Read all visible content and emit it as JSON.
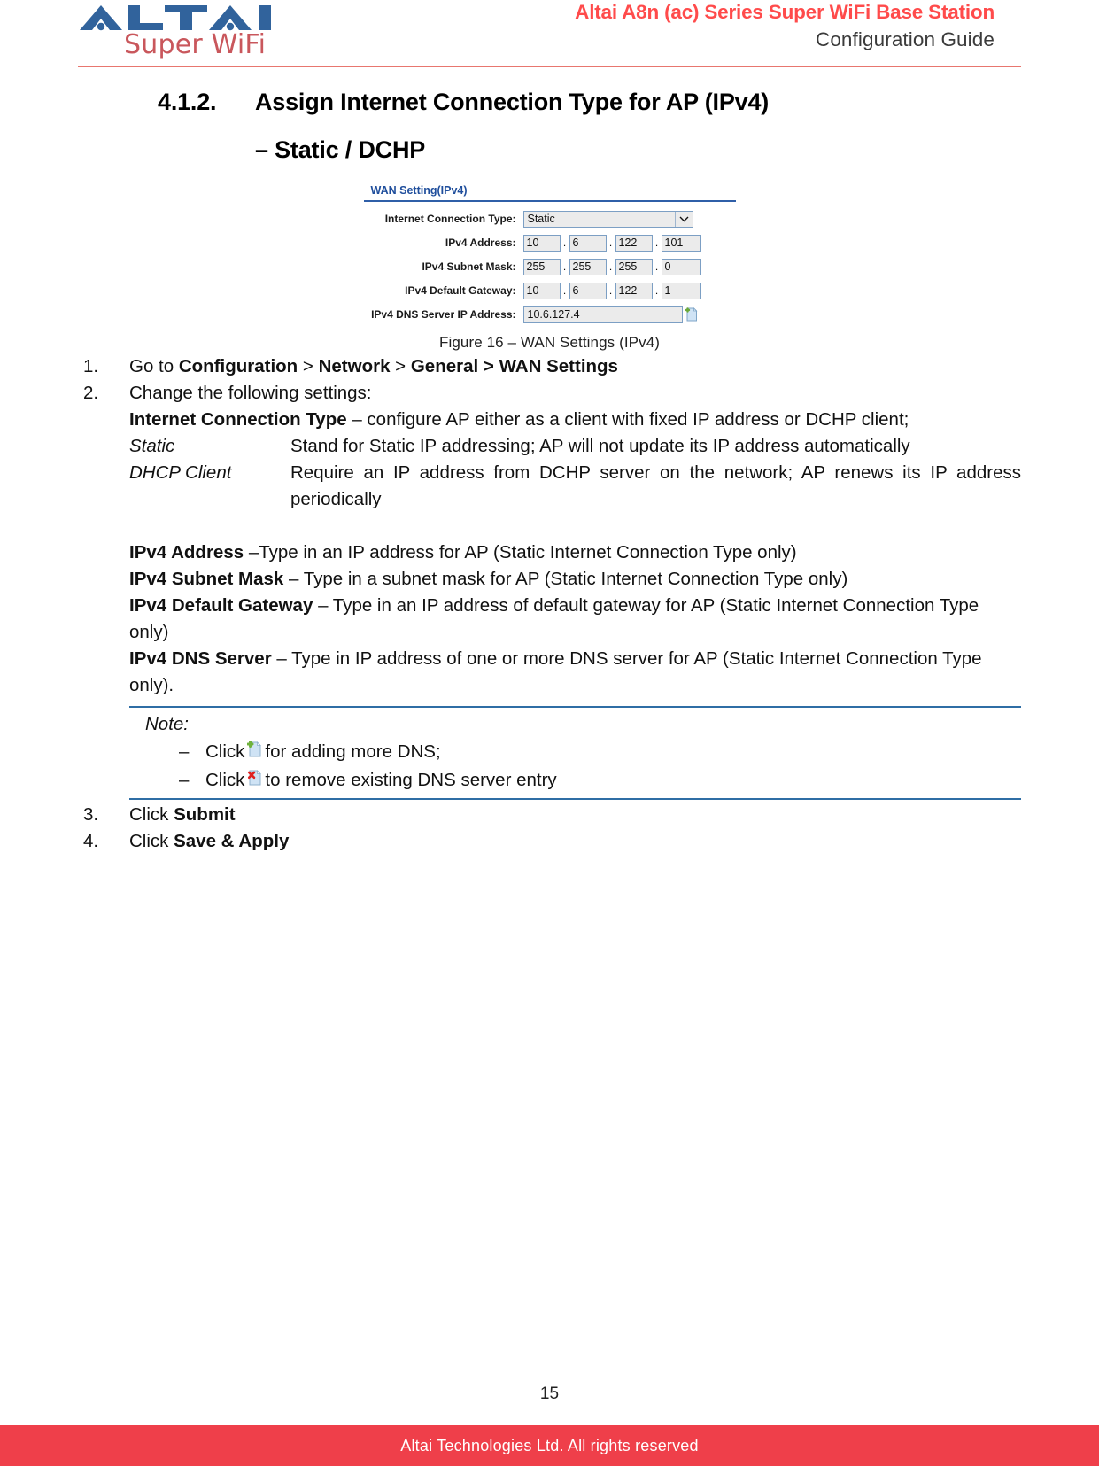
{
  "header": {
    "logo_primary": "ALTAI",
    "logo_secondary": "Super WiFi",
    "title_line1": "Altai A8n (ac) Series Super WiFi Base Station",
    "title_line2": "Configuration Guide",
    "rule_color": "#e8766f"
  },
  "section": {
    "number": "4.1.2.",
    "title": "Assign Internet Connection Type for AP (IPv4)",
    "subtitle": "– Static / DCHP"
  },
  "figure": {
    "panel_title": "WAN Setting(IPv4)",
    "caption": "Figure 16 – WAN Settings (IPv4)",
    "title_color": "#1f4e9c",
    "rows": [
      {
        "label": "Internet Connection Type:",
        "type": "select",
        "value": "Static",
        "options": [
          "Static",
          "DHCP Client"
        ]
      },
      {
        "label": "IPv4 Address:",
        "type": "octets",
        "octets": [
          "10",
          "6",
          "122",
          "101"
        ]
      },
      {
        "label": "IPv4 Subnet Mask:",
        "type": "octets",
        "octets": [
          "255",
          "255",
          "255",
          "0"
        ]
      },
      {
        "label": "IPv4 Default Gateway:",
        "type": "octets",
        "octets": [
          "10",
          "6",
          "122",
          "1"
        ]
      },
      {
        "label": "IPv4 DNS Server IP Address:",
        "type": "text",
        "value": "10.6.127.4",
        "add_icon": "add-dns-icon"
      }
    ]
  },
  "steps": {
    "step1": {
      "num": "1.",
      "prefix": "Go to ",
      "b1": "Configuration",
      "sep1": " > ",
      "b2": "Network",
      "sep2": " > ",
      "b3": "General > WAN Settings"
    },
    "step2": {
      "num": "2.",
      "text": "Change the following settings:"
    },
    "step3": {
      "num": "3.",
      "prefix": "Click ",
      "bold": "Submit"
    },
    "step4": {
      "num": "4.",
      "prefix": "Click ",
      "bold": "Save & Apply"
    }
  },
  "definitions": {
    "ict": {
      "term": "Internet Connection Type",
      "desc": " – configure AP either as a client with fixed IP address or DCHP client;"
    },
    "static": {
      "term": "Static",
      "desc": "Stand for Static IP addressing; AP will not update its IP address automatically"
    },
    "dhcp": {
      "term": "DHCP Client",
      "desc": "Require an IP address from DCHP server on the network; AP renews its IP address periodically"
    },
    "ipv4_address": {
      "term": "IPv4 Address",
      "desc": " –Type in an IP address for AP (Static Internet Connection Type only)"
    },
    "ipv4_subnet": {
      "term": "IPv4 Subnet Mask",
      "desc": " – Type in a subnet mask for AP (Static Internet Connection Type only)"
    },
    "ipv4_gateway": {
      "term": "IPv4 Default Gateway",
      "desc": " – Type in an IP address of default gateway for AP (Static Internet Connection Type only)"
    },
    "ipv4_dns": {
      "term": "IPv4 DNS Server",
      "desc": " – Type in IP address of one or more DNS server for AP (Static Internet Connection Type only)."
    }
  },
  "note": {
    "title": "Note:",
    "border_color": "#2f6ea5",
    "items": [
      {
        "dash": "–",
        "before": "Click",
        "icon": "add-dns-icon",
        "after": "for adding more DNS;"
      },
      {
        "dash": "–",
        "before": "Click",
        "icon": "remove-dns-icon",
        "after": "to remove existing DNS server entry"
      }
    ]
  },
  "footer": {
    "page_number": "15",
    "copyright": "Altai Technologies Ltd. All rights reserved",
    "bar_color": "#ef3f4a"
  }
}
